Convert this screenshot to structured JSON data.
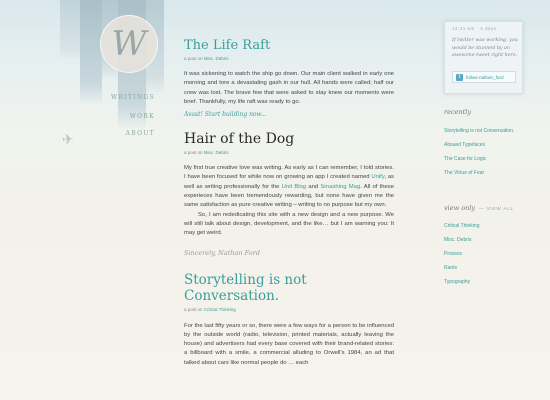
{
  "logo_letter": "W",
  "nav": [
    {
      "label": "Writings"
    },
    {
      "label": "Work"
    },
    {
      "label": "About"
    }
  ],
  "posts": [
    {
      "title": "The Life Raft",
      "meta_prefix": "a post on",
      "category": "Misc. Debris",
      "paragraph": "It was sickening to watch the ship go down. Our main client walked in early one morning and tore a devastating gash in our hull. All hands were called; half our crew was lost. The brave few that were asked to stay knew our moments were brief. Thankfully, my life raft was ready to go.",
      "more_link": "Avast! Start building now..."
    },
    {
      "title": "Hair of the Dog",
      "meta_prefix": "a post on",
      "category": "Misc. Debris",
      "p1_a": "My first true creative love was writing. As early as I can remember, I told stories. I have been focused for while now on growing an app I created named ",
      "p1_link1": "Unify",
      "p1_b": ", as well as writing professionally for the ",
      "p1_link2": "Unit Blog",
      "p1_c": " and ",
      "p1_link3": "Smashing Mag",
      "p1_d": ". All of these experieces have been tremendously rewarding, but none have given me the same satisfaction as pure creative writing – writing to no purpose but my own.",
      "p2": "So, I am rededicating this site with a new design and a new purpose. We will still talk about design, development, and the like… but I am warning you: It may get weird.",
      "signature": "Sincerely, Nathan Ford"
    },
    {
      "title": "Storytelling is not Conversation.",
      "meta_prefix": "a post on",
      "category": "Critical Thinking",
      "paragraph": "For the last fifty years or so, there were a few ways for a person to be influenced by the outside world (radio, television, printed materials, actually leaving the house) and advertisers had every base covered with their brand-related stories: a billboard with a smile, a commercial alluding to Orwell's 1984, an ad that talked about cars like normal people do … each"
    }
  ],
  "tweet": {
    "time": "12:31 am · 4 days",
    "text": "If twitter was working, you would be stunned by an awesome tweet right here.",
    "follow_label": "follow nathan_ford"
  },
  "sidebar": {
    "recently_heading": "recently",
    "recent": [
      "Storytelling is not Conversation.",
      "Absued Typefaces",
      "The Case for Logic",
      "The Virtue of Fear"
    ],
    "view_only_heading": "view only",
    "view_all": "view all",
    "categories": [
      "Critical Thinking",
      "Misc. Debris",
      "Process",
      "Rants",
      "Typography"
    ]
  }
}
